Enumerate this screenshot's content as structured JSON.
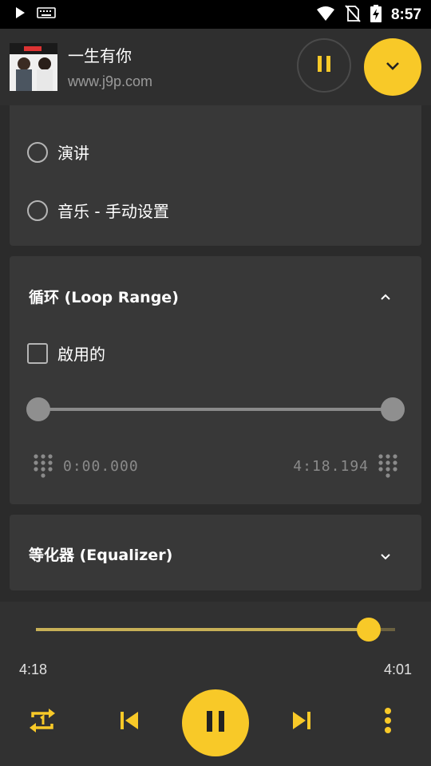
{
  "colors": {
    "accent": "#f8c928",
    "background": "#2b2b2b",
    "card": "#383838"
  },
  "status_bar": {
    "time": "8:57",
    "icons": [
      "play-icon",
      "keyboard-icon",
      "wifi-icon",
      "no-sim-icon",
      "battery-charging-icon"
    ]
  },
  "now_playing": {
    "title": "一生有你",
    "subtitle": "www.j9p.com"
  },
  "mode_panel": {
    "options": [
      {
        "label": "演讲",
        "selected": false
      },
      {
        "label": "音乐 - 手动设置",
        "selected": false
      }
    ]
  },
  "loop_panel": {
    "title": "循环 (Loop Range)",
    "enable_label": "啟用的",
    "enabled": false,
    "start_time": "0:00.000",
    "end_time": "4:18.194",
    "range_start_fraction": 0.0,
    "range_end_fraction": 1.0
  },
  "equalizer_panel": {
    "title": "等化器 (Equalizer)"
  },
  "player": {
    "position": "4:18",
    "remaining": "4:01",
    "progress_fraction": 0.94
  }
}
